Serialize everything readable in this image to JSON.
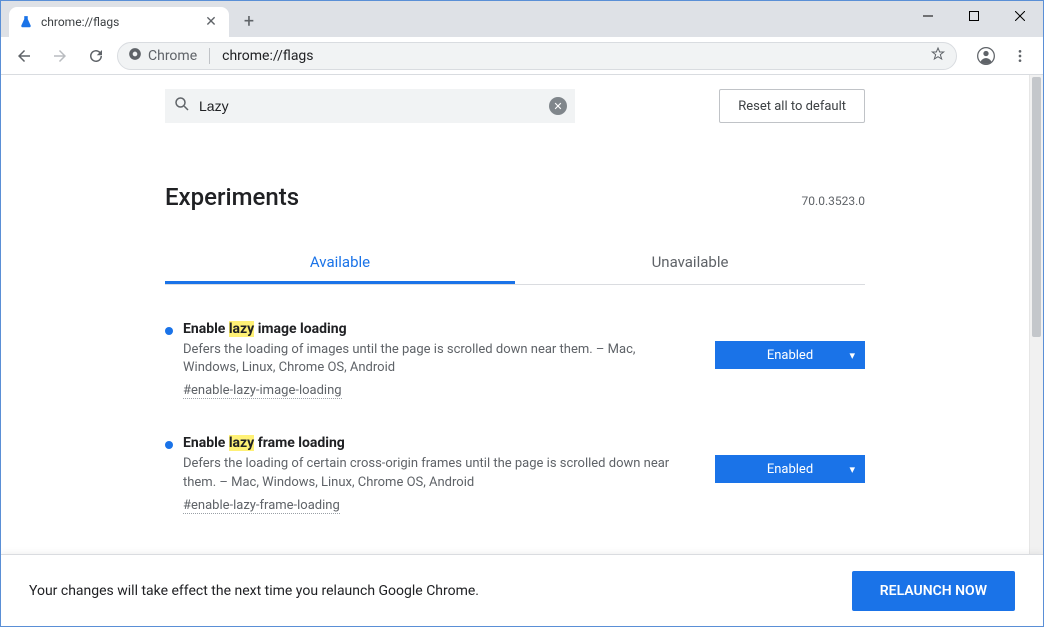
{
  "window": {
    "tab_title": "chrome://flags"
  },
  "toolbar": {
    "scheme_label": "Chrome",
    "url": "chrome://flags"
  },
  "search": {
    "value": "Lazy"
  },
  "reset_all_label": "Reset all to default",
  "heading": "Experiments",
  "version": "70.0.3523.0",
  "tabs": {
    "available": "Available",
    "unavailable": "Unavailable"
  },
  "flags": [
    {
      "title_pre": "Enable ",
      "title_hl": "lazy",
      "title_post": " image loading",
      "desc": "Defers the loading of images until the page is scrolled down near them. – Mac, Windows, Linux, Chrome OS, Android",
      "hash": "#enable-lazy-image-loading",
      "state": "Enabled"
    },
    {
      "title_pre": "Enable ",
      "title_hl": "lazy",
      "title_post": " frame loading",
      "desc": "Defers the loading of certain cross-origin frames until the page is scrolled down near them. – Mac, Windows, Linux, Chrome OS, Android",
      "hash": "#enable-lazy-frame-loading",
      "state": "Enabled"
    }
  ],
  "relaunch": {
    "message": "Your changes will take effect the next time you relaunch Google Chrome.",
    "button": "RELAUNCH NOW"
  }
}
